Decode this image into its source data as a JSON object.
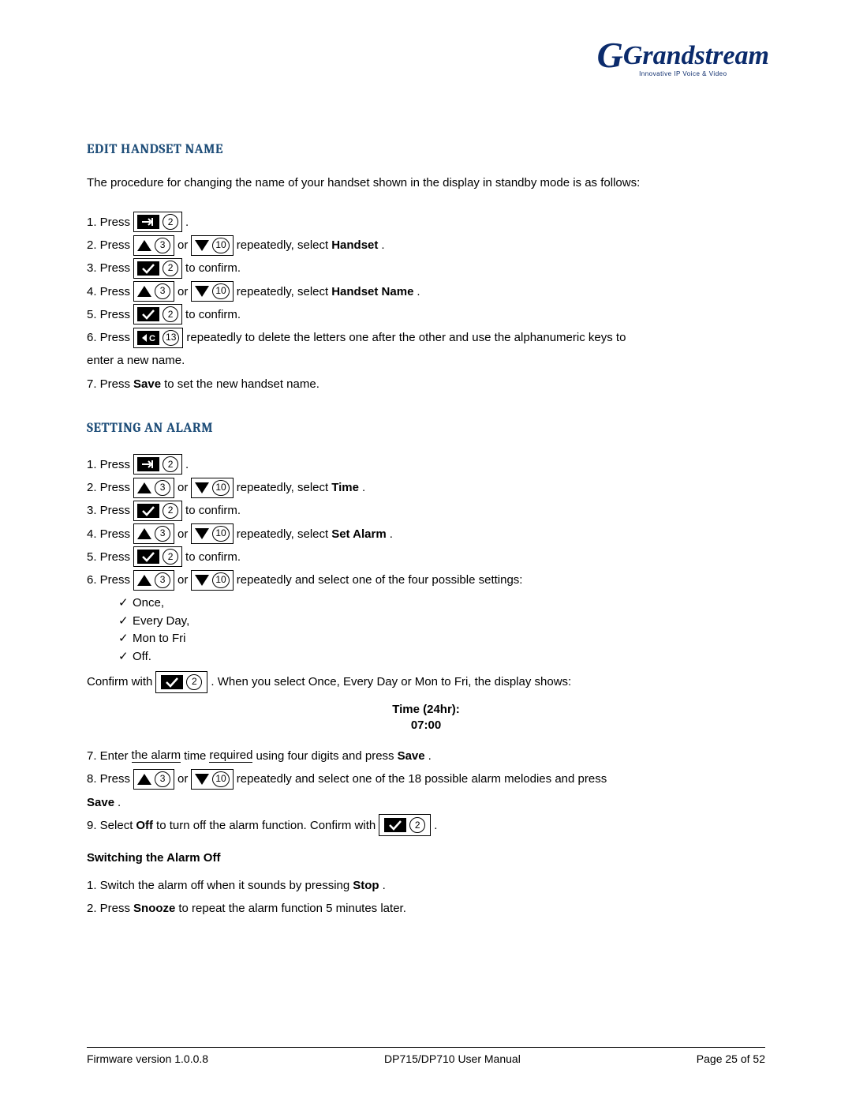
{
  "logo": {
    "brand": "Grandstream",
    "tagline": "Innovative IP Voice & Video"
  },
  "sections": {
    "edit_handset": {
      "title": "EDIT HANDSET NAME",
      "intro": "The procedure for changing the name of your handset shown in the display in standby mode is as follows:",
      "steps": {
        "s1_prefix": "1.  Press",
        "s1_suffix": ".",
        "s2_prefix": "2.  Press",
        "s2_or": "or",
        "s2_mid": "repeatedly, select ",
        "s2_bold": "Handset",
        "s2_suffix": ".",
        "s3_prefix": "3.  Press",
        "s3_suffix": "to confirm.",
        "s4_prefix": "4.  Press",
        "s4_or": "or",
        "s4_mid": "repeatedly, select ",
        "s4_bold": "Handset Name",
        "s4_suffix": ".",
        "s5_prefix": "5.  Press",
        "s5_suffix": "to confirm.",
        "s6_prefix": "6.  Press",
        "s6_suffix": "repeatedly to delete the letters one after the other and use the alphanumeric keys to",
        "s6_cont": "enter a new name.",
        "s7_a": "7.  Press ",
        "s7_bold": "Save",
        "s7_b": " to set the new handset name."
      },
      "key_labels": {
        "menu": "2",
        "up": "3",
        "down": "10",
        "ok": "2",
        "clear": "13"
      }
    },
    "set_alarm": {
      "title": "SETTING AN ALARM",
      "steps": {
        "s1_prefix": "1.  Press",
        "s1_suffix": ".",
        "s2_prefix": "2.  Press",
        "s2_or": "or",
        "s2_mid": "repeatedly, select ",
        "s2_bold": "Time",
        "s2_suffix": ".",
        "s3_prefix": "3.  Press",
        "s3_suffix": "to confirm.",
        "s4_prefix": "4.  Press",
        "s4_or": "or",
        "s4_mid": "repeatedly, select ",
        "s4_bold": "Set Alarm",
        "s4_suffix": ".",
        "s5_prefix": "5.  Press",
        "s5_suffix": "to confirm.",
        "s6_prefix": "6.  Press",
        "s6_or": "or",
        "s6_suffix": "repeatedly and select one of the four possible settings:",
        "opt1": "Once,",
        "opt2": "Every Day,",
        "opt3": "Mon to Fri",
        "opt4": "Off.",
        "confirm_a": "Confirm with",
        "confirm_b": ". When you select Once, Every Day or Mon to Fri, the display shows:",
        "time_label": "Time (24hr):",
        "time_value": "07:00",
        "s7_a": "7.  Enter ",
        "s7_u": "the alarm",
        "s7_b": " time ",
        "s7_u2": "required",
        "s7_c": " using four digits and press ",
        "s7_bold": "Save",
        "s7_suffix": ".",
        "s8_prefix": "8.  Press",
        "s8_or": "or",
        "s8_suffix": "repeatedly and select one of the 18 possible alarm melodies and press",
        "s8_bold": "Save",
        "s8_end": ".",
        "s9_a": "9.  Select ",
        "s9_bold": "Off",
        "s9_b": " to turn off the alarm function. Confirm with ",
        "s9_suffix": "."
      },
      "subhead": "Switching the Alarm Off",
      "off": {
        "s1_a": "1.  Switch the alarm off when it sounds by pressing ",
        "s1_bold": "Stop",
        "s1_b": ".",
        "s2_a": "2.  Press ",
        "s2_bold": "Snooze",
        "s2_b": " to repeat the alarm function 5 minutes later."
      },
      "key_labels": {
        "menu": "2",
        "up": "3",
        "down": "10",
        "ok": "2"
      }
    }
  },
  "footer": {
    "left": "Firmware version 1.0.0.8",
    "center": "DP715/DP710 User Manual",
    "right": "Page 25 of 52"
  }
}
